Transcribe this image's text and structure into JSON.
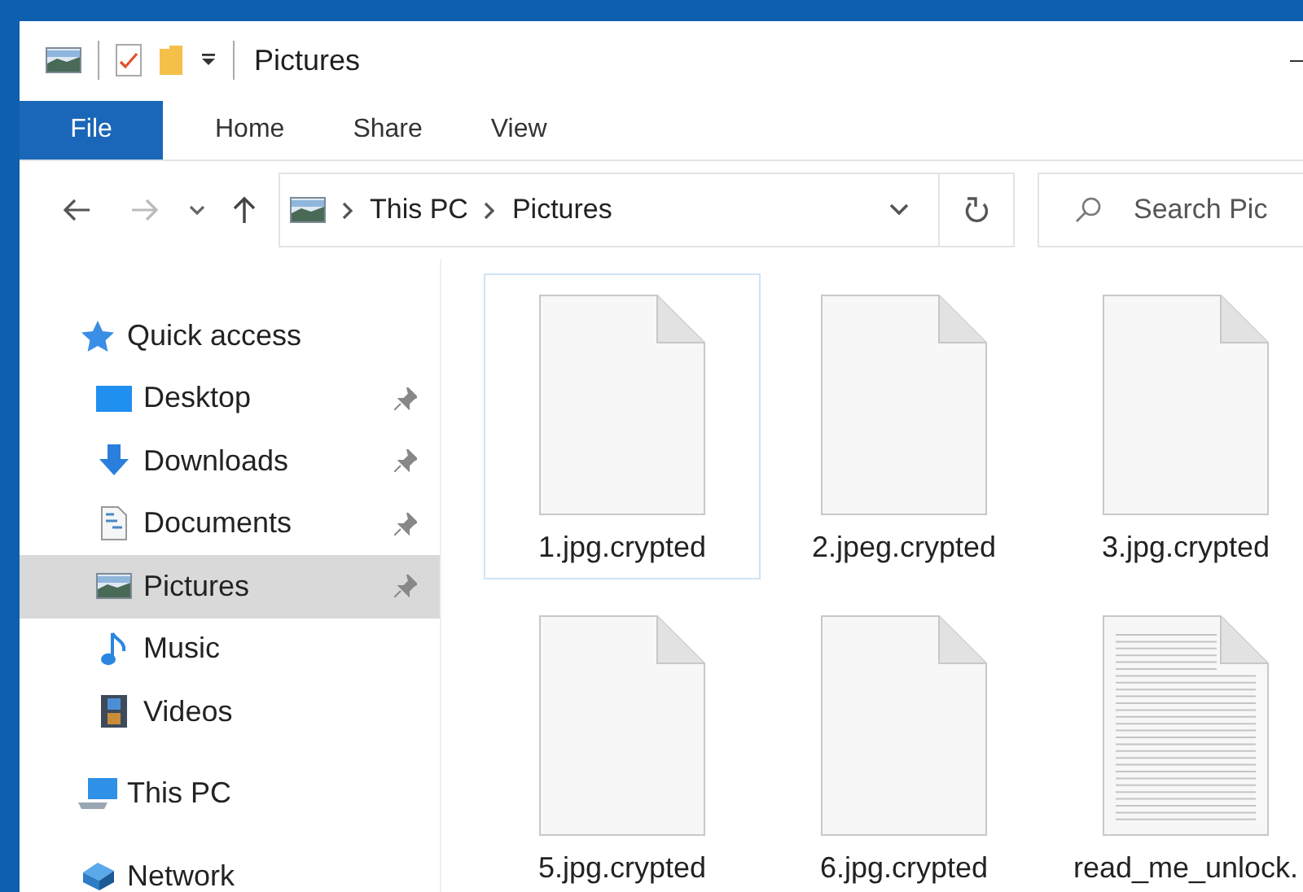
{
  "window": {
    "title": "Pictures"
  },
  "ribbon": {
    "tabs": [
      {
        "label": "File",
        "selected": true
      },
      {
        "label": "Home",
        "selected": false
      },
      {
        "label": "Share",
        "selected": false
      },
      {
        "label": "View",
        "selected": false
      }
    ]
  },
  "address_bar": {
    "path": [
      "This PC",
      "Pictures"
    ]
  },
  "search": {
    "placeholder": "Search Pic"
  },
  "sidebar": {
    "items": [
      {
        "label": "Quick access",
        "kind": "star",
        "selected": false,
        "children": [
          {
            "label": "Desktop",
            "kind": "desktop",
            "pinned": true,
            "selected": false
          },
          {
            "label": "Downloads",
            "kind": "download",
            "pinned": true,
            "selected": false
          },
          {
            "label": "Documents",
            "kind": "document",
            "pinned": true,
            "selected": false
          },
          {
            "label": "Pictures",
            "kind": "pictures",
            "pinned": true,
            "selected": true
          },
          {
            "label": "Music",
            "kind": "music",
            "pinned": false,
            "selected": false
          },
          {
            "label": "Videos",
            "kind": "videos",
            "pinned": false,
            "selected": false
          }
        ]
      },
      {
        "label": "This PC",
        "kind": "computer",
        "selected": false
      },
      {
        "label": "Network",
        "kind": "network",
        "selected": false
      }
    ]
  },
  "files": [
    {
      "name": "1.jpg.crypted",
      "kind": "blank",
      "selected": true
    },
    {
      "name": "2.jpeg.crypted",
      "kind": "blank",
      "selected": false
    },
    {
      "name": "3.jpg.crypted",
      "kind": "blank",
      "selected": false
    },
    {
      "name": "5.jpg.crypted",
      "kind": "blank",
      "selected": false
    },
    {
      "name": "6.jpg.crypted",
      "kind": "blank",
      "selected": false
    },
    {
      "name": "read_me_unlock.",
      "kind": "text",
      "selected": false
    }
  ]
}
